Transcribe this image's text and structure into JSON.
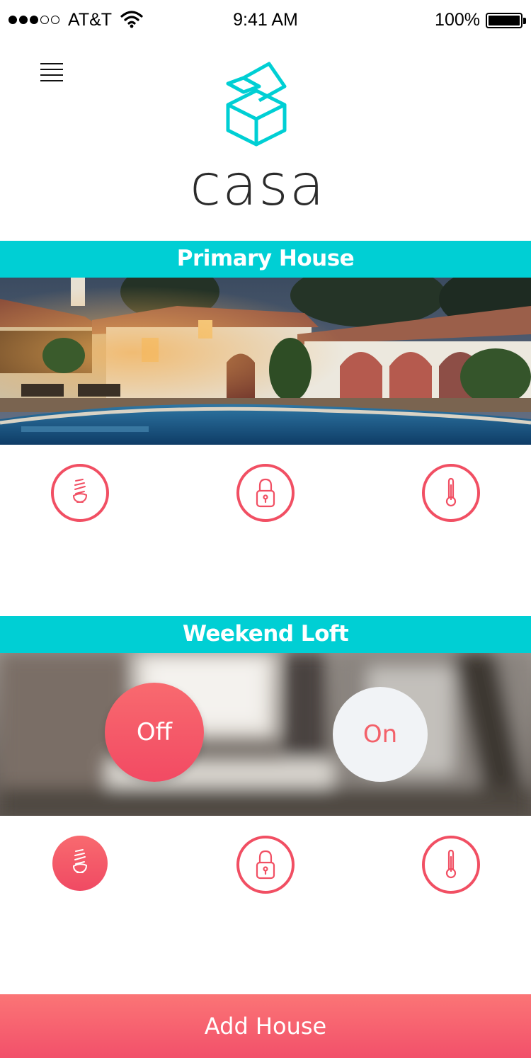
{
  "status_bar": {
    "carrier": "AT&T",
    "time": "9:41 AM",
    "battery": "100%",
    "signal_bars_filled": 3,
    "signal_bars_total": 5
  },
  "header": {
    "brand": "casa",
    "menu_icon": "hamburger-menu-icon",
    "logo_icon": "open-box-icon"
  },
  "houses": [
    {
      "name": "Primary House",
      "controls": [
        {
          "icon": "light-bulb-icon",
          "active": false
        },
        {
          "icon": "lock-icon",
          "active": false
        },
        {
          "icon": "thermometer-icon",
          "active": false
        }
      ]
    },
    {
      "name": "Weekend Loft",
      "toggle": {
        "off_label": "Off",
        "on_label": "On",
        "selected": "Off"
      },
      "controls": [
        {
          "icon": "light-bulb-icon",
          "active": true
        },
        {
          "icon": "lock-icon",
          "active": false
        },
        {
          "icon": "thermometer-icon",
          "active": false
        }
      ]
    }
  ],
  "footer": {
    "add_label": "Add House"
  },
  "colors": {
    "accent_teal": "#00cfd4",
    "accent_coral": "#f14f63",
    "brand_text": "#2b2b2b"
  }
}
